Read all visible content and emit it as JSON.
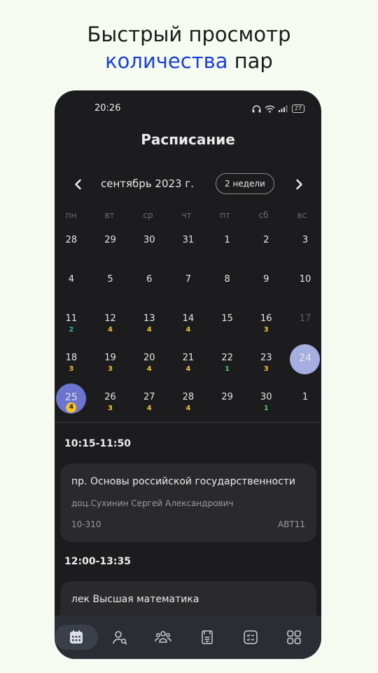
{
  "promo": {
    "line1": "Быстрый просмотр",
    "highlight": "количества",
    "rest": " пар"
  },
  "status": {
    "time": "20:26",
    "battery": "27"
  },
  "header": {
    "title": "Расписание"
  },
  "calendar": {
    "month_label": "сентябрь 2023 г.",
    "mode_label": "2 недели",
    "weekdays": [
      "пн",
      "вт",
      "ср",
      "чт",
      "пт",
      "сб",
      "вс"
    ],
    "weeks": [
      [
        {
          "d": "28",
          "c": ""
        },
        {
          "d": "29",
          "c": ""
        },
        {
          "d": "30",
          "c": ""
        },
        {
          "d": "31",
          "c": ""
        },
        {
          "d": "1",
          "c": ""
        },
        {
          "d": "2",
          "c": ""
        },
        {
          "d": "3",
          "c": ""
        }
      ],
      [
        {
          "d": "4",
          "c": ""
        },
        {
          "d": "5",
          "c": ""
        },
        {
          "d": "6",
          "c": ""
        },
        {
          "d": "7",
          "c": ""
        },
        {
          "d": "8",
          "c": ""
        },
        {
          "d": "9",
          "c": ""
        },
        {
          "d": "10",
          "c": ""
        }
      ],
      [
        {
          "d": "11",
          "c": "2",
          "t": "teal"
        },
        {
          "d": "12",
          "c": "4",
          "t": "yellow"
        },
        {
          "d": "13",
          "c": "4",
          "t": "yellow"
        },
        {
          "d": "14",
          "c": "4",
          "t": "yellow"
        },
        {
          "d": "15",
          "c": ""
        },
        {
          "d": "16",
          "c": "3",
          "t": "yellow"
        },
        {
          "d": "17",
          "c": "",
          "dim": true
        }
      ],
      [
        {
          "d": "18",
          "c": "3",
          "t": "yellow"
        },
        {
          "d": "19",
          "c": "3",
          "t": "yellow"
        },
        {
          "d": "20",
          "c": "4",
          "t": "yellow"
        },
        {
          "d": "21",
          "c": "4",
          "t": "yellow"
        },
        {
          "d": "22",
          "c": "1",
          "t": "green"
        },
        {
          "d": "23",
          "c": "3",
          "t": "yellow"
        },
        {
          "d": "24",
          "c": "",
          "selected": true
        }
      ],
      [
        {
          "d": "25",
          "c": "4",
          "t": "yellow",
          "today": true
        },
        {
          "d": "26",
          "c": "3",
          "t": "yellow"
        },
        {
          "d": "27",
          "c": "4",
          "t": "yellow"
        },
        {
          "d": "28",
          "c": "4",
          "t": "yellow"
        },
        {
          "d": "29",
          "c": ""
        },
        {
          "d": "30",
          "c": "1",
          "t": "green"
        },
        {
          "d": "1",
          "c": ""
        }
      ]
    ]
  },
  "schedule": [
    {
      "time": "10:15-11:50",
      "name": "пр. Основы российской государственности",
      "teacher": "доц.Сухинин Сергей Александрович",
      "room": "10-310",
      "group": "АВТ11"
    },
    {
      "time": "12:00-13:35",
      "name": "лек Высшая математика",
      "teacher": "",
      "room": "",
      "group": ""
    }
  ],
  "tabs": [
    "calendar-icon",
    "search-person-icon",
    "groups-icon",
    "documents-icon",
    "checklist-icon",
    "apps-grid-icon"
  ],
  "colors": {
    "selected": "#a4aee0",
    "today": "#6b74cf",
    "accent": "#1b3fd6"
  }
}
